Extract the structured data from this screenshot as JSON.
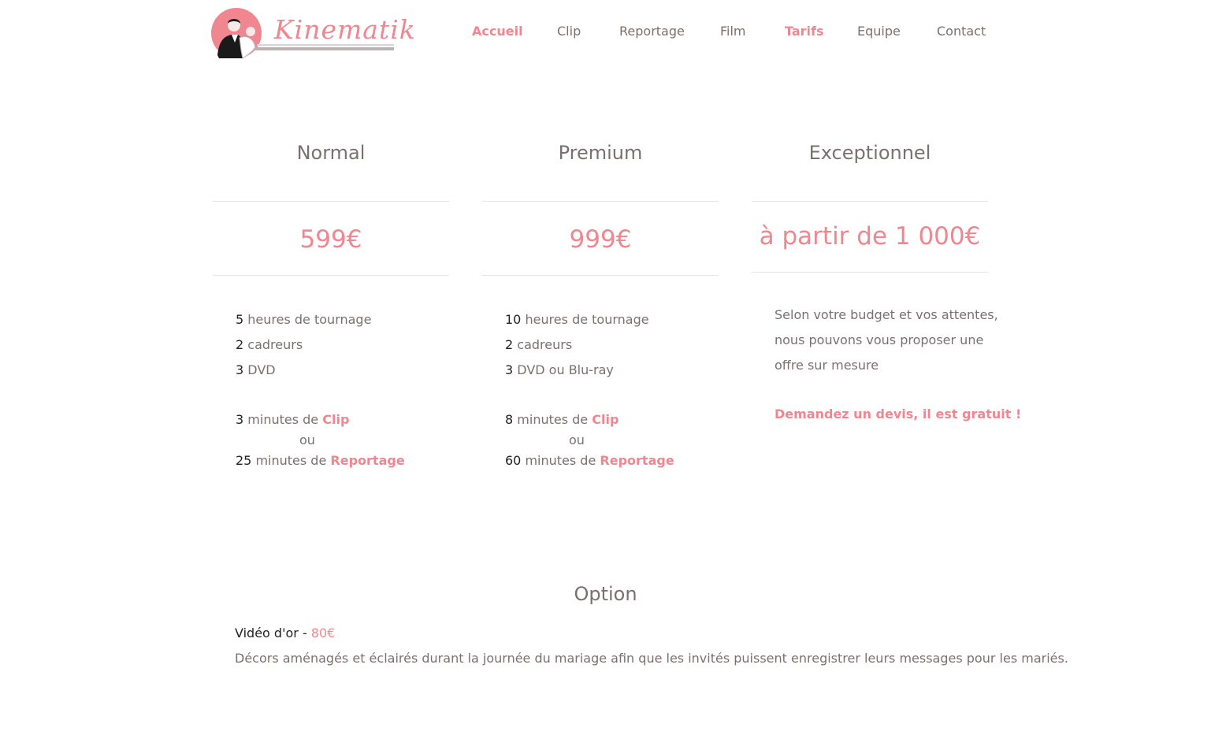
{
  "brand": {
    "name": "Kinematik",
    "accent_color": "#f0868f",
    "logo_icon": "wedding-couple-icon"
  },
  "nav": {
    "items": [
      {
        "label": "Accueil",
        "active": true
      },
      {
        "label": "Clip",
        "active": false
      },
      {
        "label": "Reportage",
        "active": false
      },
      {
        "label": "Film",
        "active": false
      },
      {
        "label": "Tarifs",
        "active": true
      },
      {
        "label": "Equipe",
        "active": false
      },
      {
        "label": "Contact",
        "active": false
      }
    ]
  },
  "plans": [
    {
      "name": "Normal",
      "price": "599€",
      "features": [
        {
          "num": "5",
          "text": "heures de tournage"
        },
        {
          "num": "2",
          "text": "cadreurs"
        },
        {
          "num": "3",
          "text": "DVD"
        }
      ],
      "extras": {
        "clip": {
          "num": "3",
          "text": "minutes de",
          "link": "Clip"
        },
        "or": "ou",
        "report": {
          "num": "25",
          "text": "minutes de",
          "link": "Reportage"
        }
      }
    },
    {
      "name": "Premium",
      "price": "999€",
      "features": [
        {
          "num": "10",
          "text": "heures de tournage"
        },
        {
          "num": "2",
          "text": "cadreurs"
        },
        {
          "num": "3",
          "text": "DVD ou Blu-ray"
        }
      ],
      "extras": {
        "clip": {
          "num": "8",
          "text": "minutes de",
          "link": "Clip"
        },
        "or": "ou",
        "report": {
          "num": "60",
          "text": "minutes de",
          "link": "Reportage"
        }
      }
    },
    {
      "name": "Exceptionnel",
      "price": "à partir de 1 000€",
      "description": [
        "Selon votre budget et vos attentes,",
        "nous pouvons vous proposer une",
        "offre sur mesure"
      ],
      "cta": "Demandez un devis, il est gratuit !"
    }
  ],
  "option": {
    "title": "Option",
    "name": "Vidéo d'or",
    "separator": "-",
    "price": "80€",
    "description": "Décors aménagés et éclairés durant la journée du mariage afin que les invités puissent enregistrer leurs messages pour les mariés."
  }
}
